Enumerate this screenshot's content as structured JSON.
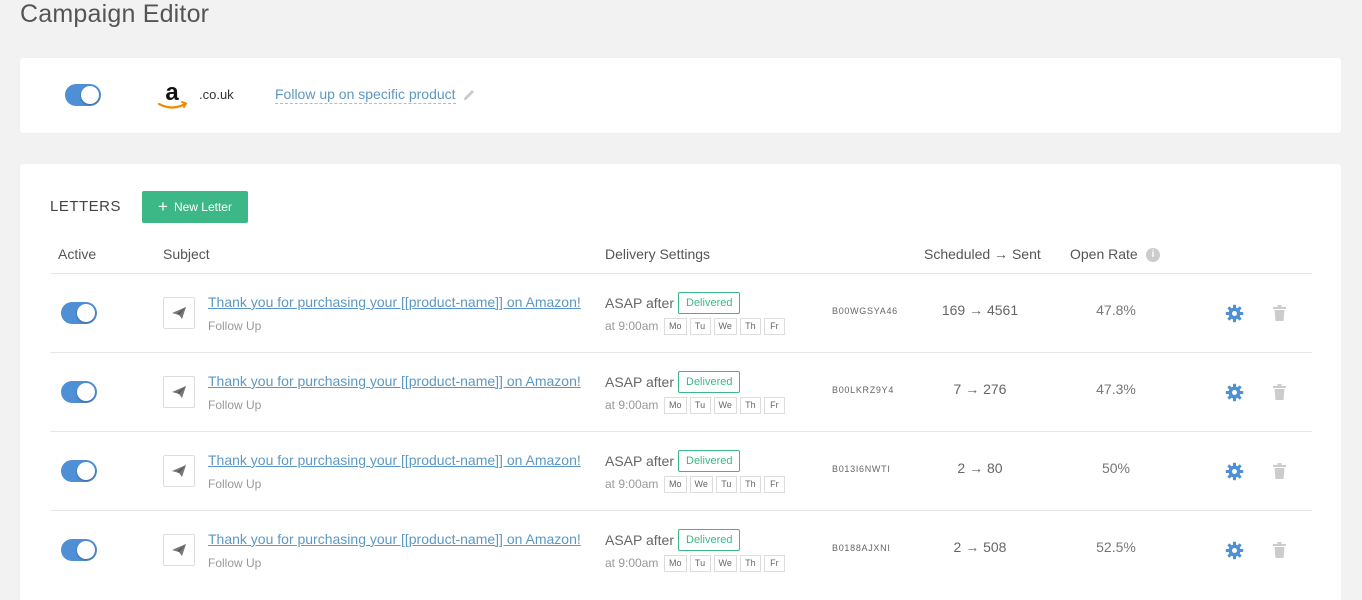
{
  "page": {
    "title": "Campaign Editor"
  },
  "campaign": {
    "marketplace_domain": ".co.uk",
    "name": "Follow up on specific product",
    "active": true
  },
  "colors": {
    "accent_blue": "#4f8fd6",
    "link_blue": "#5d98c2",
    "green": "#3cb887"
  },
  "letters": {
    "heading": "LETTERS",
    "new_letter_label": "New Letter",
    "columns": {
      "active": "Active",
      "subject": "Subject",
      "delivery": "Delivery Settings",
      "scheduled_sent": "Scheduled → Sent",
      "open_rate": "Open Rate"
    },
    "rows": [
      {
        "active": true,
        "subject": "Thank you for purchasing your [[product-name]] on Amazon!",
        "type": "Follow Up",
        "timing": "ASAP after",
        "status": "Delivered",
        "time": "at 9:00am",
        "days": [
          "Mo",
          "Tu",
          "We",
          "Th",
          "Fr"
        ],
        "asin": "B00WGSYA46",
        "scheduled_sent": "169 → 4561",
        "open_rate": "47.8%"
      },
      {
        "active": true,
        "subject": "Thank you for purchasing your [[product-name]] on Amazon!",
        "type": "Follow Up",
        "timing": "ASAP after",
        "status": "Delivered",
        "time": "at 9:00am",
        "days": [
          "Mo",
          "Tu",
          "We",
          "Th",
          "Fr"
        ],
        "asin": "B00LKRZ9Y4",
        "scheduled_sent": "7 → 276",
        "open_rate": "47.3%"
      },
      {
        "active": true,
        "subject": "Thank you for purchasing your [[product-name]] on Amazon!",
        "type": "Follow Up",
        "timing": "ASAP after",
        "status": "Delivered",
        "time": "at 9:00am",
        "days": [
          "Mo",
          "We",
          "Tu",
          "Th",
          "Fr"
        ],
        "asin": "B013I6NWTI",
        "scheduled_sent": "2 → 80",
        "open_rate": "50%"
      },
      {
        "active": true,
        "subject": "Thank you for purchasing your [[product-name]] on Amazon!",
        "type": "Follow Up",
        "timing": "ASAP after",
        "status": "Delivered",
        "time": "at 9:00am",
        "days": [
          "Mo",
          "Tu",
          "We",
          "Th",
          "Fr"
        ],
        "asin": "B0188AJXNI",
        "scheduled_sent": "2 → 508",
        "open_rate": "52.5%"
      }
    ]
  }
}
